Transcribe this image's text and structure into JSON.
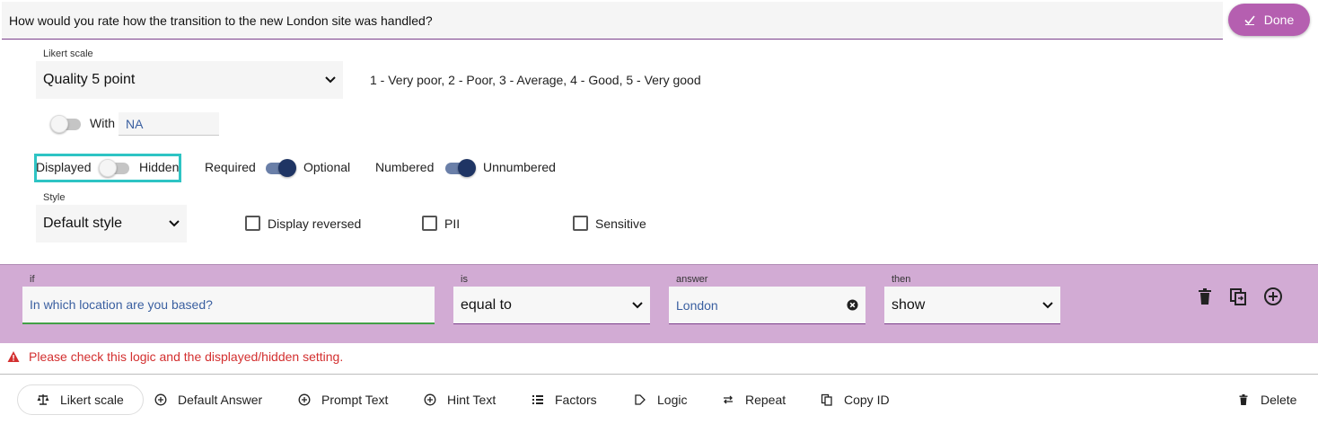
{
  "question": {
    "text": "How would you rate how the transition to the new London site was handled?"
  },
  "done_button": {
    "label": "Done"
  },
  "likert": {
    "label": "Likert scale",
    "selected": "Quality 5 point",
    "description": "1 - Very poor, 2 - Poor, 3 - Average, 4 - Good, 5 - Very good"
  },
  "with_na": {
    "label": "With",
    "value": "NA"
  },
  "toggles": {
    "displayed_label": "Displayed",
    "hidden_label": "Hidden",
    "required_label": "Required",
    "optional_label": "Optional",
    "numbered_label": "Numbered",
    "unnumbered_label": "Unnumbered"
  },
  "style": {
    "label": "Style",
    "selected": "Default style"
  },
  "checkboxes": {
    "display_reversed": "Display reversed",
    "pii": "PII",
    "sensitive": "Sensitive"
  },
  "logic": {
    "if_label": "if",
    "if_value": "In which location are you based?",
    "is_label": "is",
    "is_value": "equal to",
    "answer_label": "answer",
    "answer_value": "London",
    "then_label": "then",
    "then_value": "show"
  },
  "warning": {
    "text": "Please check this logic and the displayed/hidden setting."
  },
  "toolbar": {
    "likert_scale": "Likert scale",
    "default_answer": "Default Answer",
    "prompt_text": "Prompt Text",
    "hint_text": "Hint Text",
    "factors": "Factors",
    "logic": "Logic",
    "repeat": "Repeat",
    "copy_id": "Copy ID",
    "delete": "Delete"
  },
  "colors": {
    "accent": "#b55fb0",
    "logic_band": "#d2abd4",
    "highlight": "#2ec4c4",
    "toggle_on": "#1f3564",
    "warning": "#d32f2f"
  }
}
